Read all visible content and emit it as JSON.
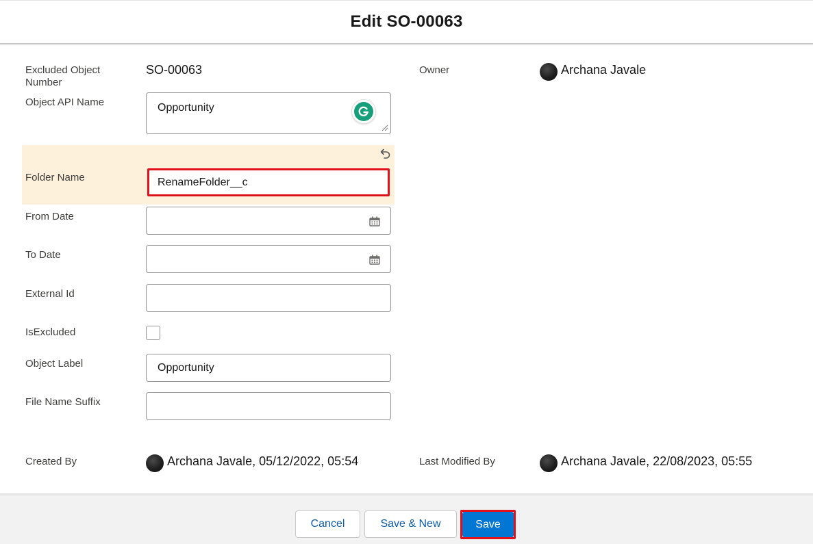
{
  "modal": {
    "title": "Edit SO-00063"
  },
  "fields": {
    "excluded_object_number": {
      "label": "Excluded Object\nNumber",
      "value": "SO-00063"
    },
    "owner": {
      "label": "Owner",
      "value": "Archana Javale"
    },
    "object_api_name": {
      "label": "Object API Name",
      "value": "Opportunity"
    },
    "folder_name": {
      "label": "Folder Name",
      "value": "RenameFolder__c"
    },
    "from_date": {
      "label": "From Date",
      "value": ""
    },
    "to_date": {
      "label": "To Date",
      "value": ""
    },
    "external_id": {
      "label": "External Id",
      "value": ""
    },
    "is_excluded": {
      "label": "IsExcluded",
      "checked": false
    },
    "object_label": {
      "label": "Object Label",
      "value": "Opportunity"
    },
    "file_name_suffix": {
      "label": "File Name Suffix",
      "value": ""
    },
    "created_by": {
      "label": "Created By",
      "value": "Archana Javale, 05/12/2022, 05:54"
    },
    "last_modified_by": {
      "label": "Last Modified By",
      "value": "Archana Javale, 22/08/2023, 05:55"
    }
  },
  "footer": {
    "cancel_label": "Cancel",
    "save_new_label": "Save & New",
    "save_label": "Save"
  },
  "icons": {
    "grammarly": "grammarly-icon",
    "undo": "undo-icon",
    "calendar": "calendar-icon",
    "avatar": "user-avatar"
  },
  "colors": {
    "brand": "#0176d3",
    "highlight_row": "#fdf1dc",
    "annotation_border": "#e0101d",
    "footer_bg": "#f3f2f2"
  }
}
